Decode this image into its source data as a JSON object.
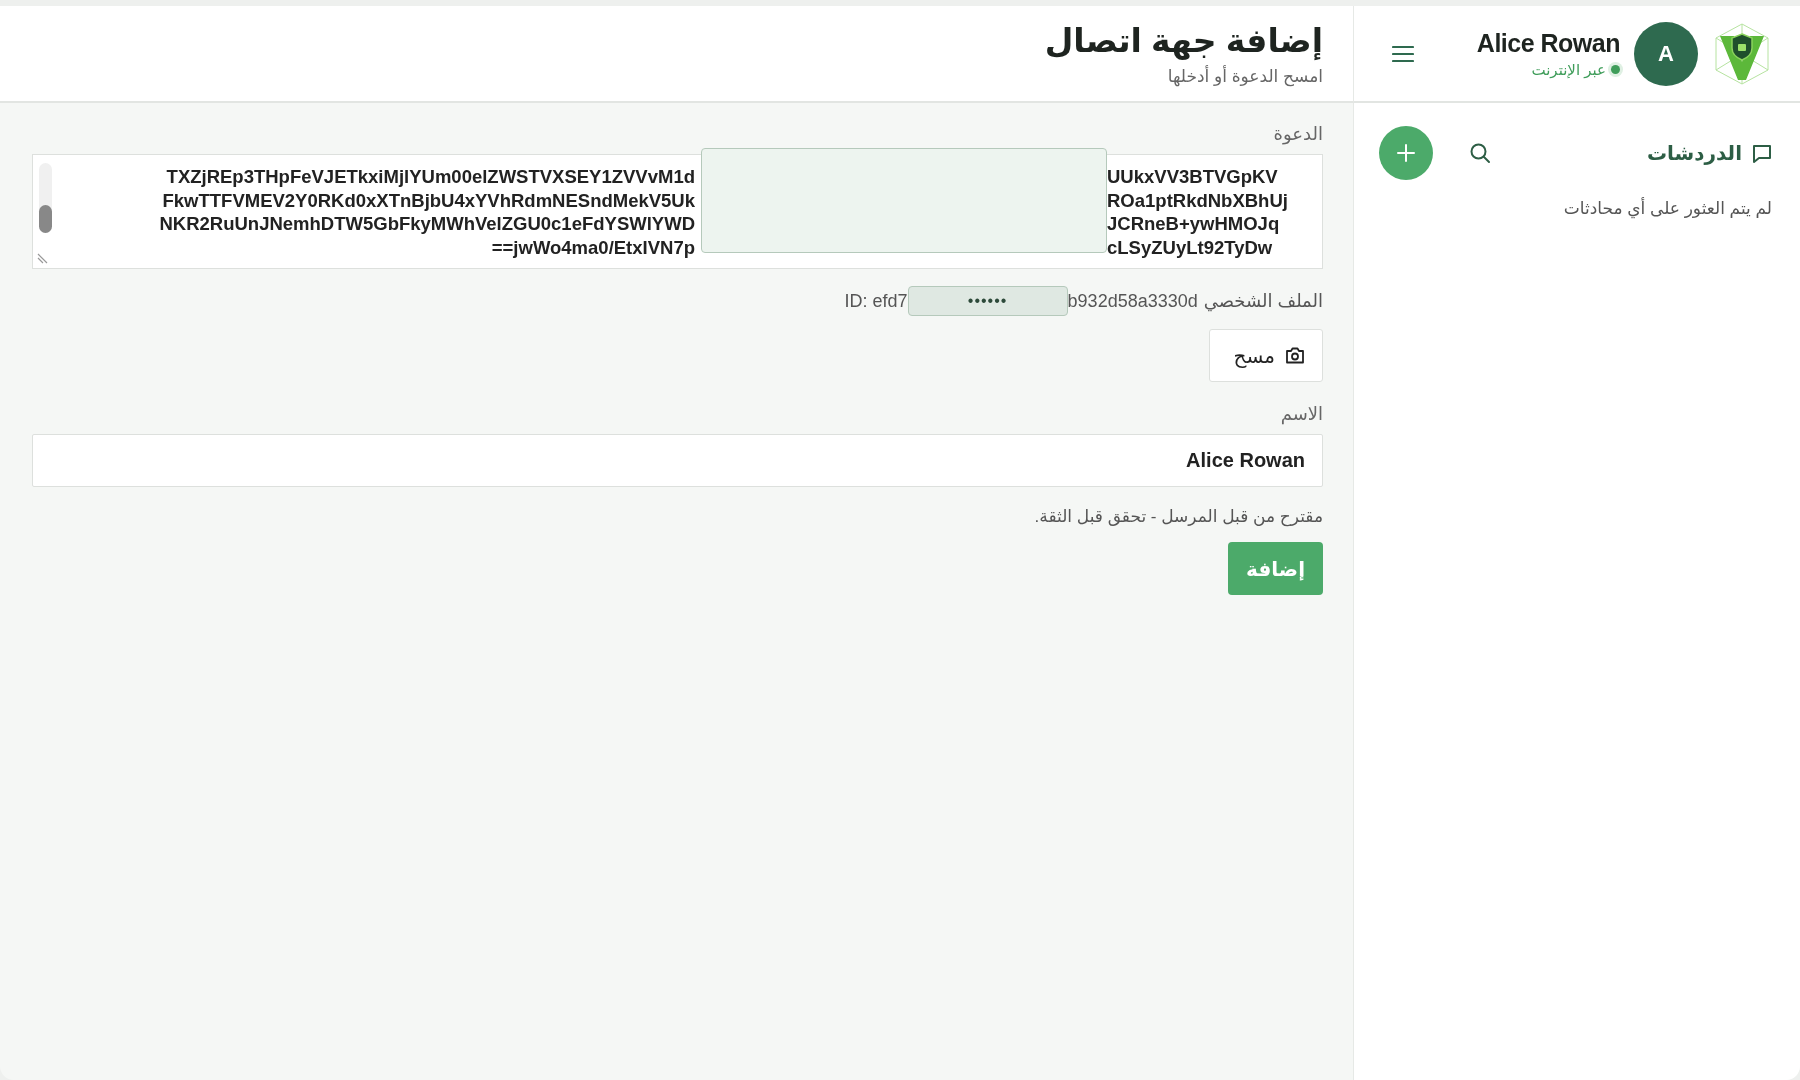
{
  "account": {
    "user_name": "Alice Rowan",
    "avatar_initial": "A",
    "status": "عبر الإنترنت",
    "online": true
  },
  "page_header": {
    "title": "إضافة جهة اتصال",
    "subtitle": "امسح الدعوة أو أدخلها"
  },
  "sidebar": {
    "title": "الدردشات",
    "empty_text": "لم يتم العثور على أي محادثات"
  },
  "form": {
    "invite_label": "الدعوة",
    "invite_lines": [
      {
        "start": "TXZjREp3THpFeVJETkxiMjlYUm00elZWSTVXSEY1ZVVvM1d",
        "end": "UUkxVV3BTVGpKV"
      },
      {
        "start": "FkwTTFVMEV2Y0RKd0xXTnBjbU4xYVhRdmNESndMekV5Uk",
        "end": "ROa1ptRkdNbXBhUj"
      },
      {
        "start": "NKR2RuUnJNemhDTW5GbFkyMWhVelZGU0c1eFdYSWlYWD",
        "end": "JCRneB+ywHMOJq"
      },
      {
        "start": "==jwWo4ma0/EtxIVN7p",
        "end": "cLSyZUyLt92TyDw"
      }
    ],
    "profile": {
      "label": "الملف الشخصي",
      "id_start": "ID: efd7",
      "masked": "••••••",
      "id_end": "b932d58a3330d"
    },
    "scan_button": "مسح",
    "name_label": "الاسم",
    "name_value": "Alice Rowan",
    "hint": "مقترح من قبل المرسل - تحقق قبل الثقة.",
    "add_button": "إضافة"
  }
}
